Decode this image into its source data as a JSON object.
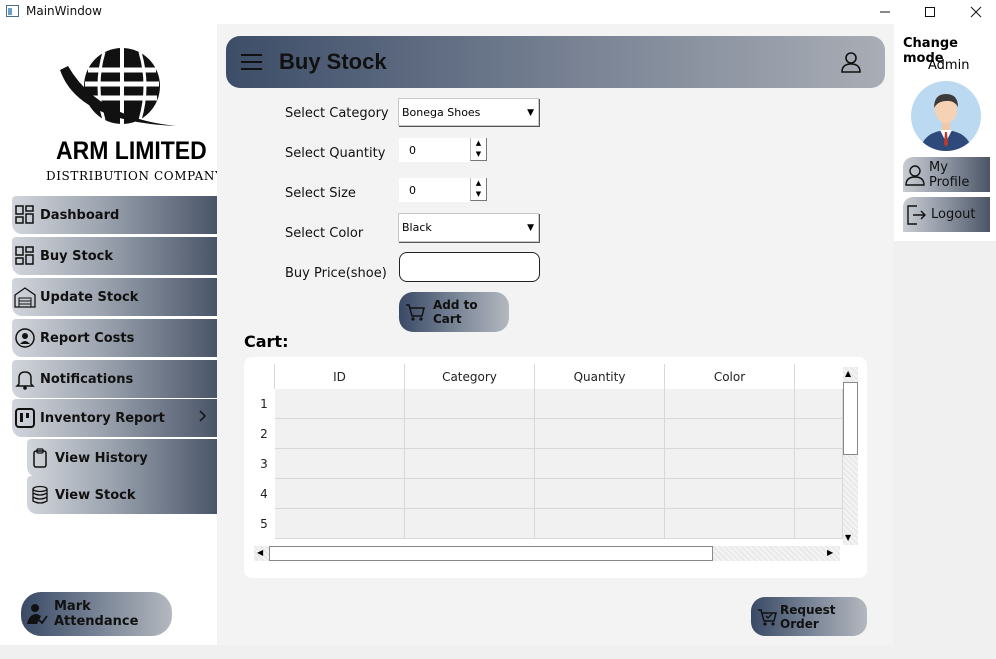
{
  "window": {
    "title": "MainWindow",
    "min_icon": "minimize-icon",
    "max_icon": "maximize-icon",
    "close_icon": "close-icon"
  },
  "logo": {
    "line1": "ARM LIMITED",
    "line2": "DISTRIBUTION COMPANY"
  },
  "sidebar": {
    "items": [
      {
        "label": "Dashboard",
        "icon": "dashboard-icon"
      },
      {
        "label": "Buy Stock",
        "icon": "grid-icon"
      },
      {
        "label": "Update Stock",
        "icon": "warehouse-icon"
      },
      {
        "label": "Report Costs",
        "icon": "cost-report-icon"
      },
      {
        "label": "Notifications",
        "icon": "bell-icon"
      },
      {
        "label": "Inventory Report",
        "icon": "board-icon"
      },
      {
        "label": "View History",
        "icon": "clipboard-icon"
      },
      {
        "label": "View Stock",
        "icon": "database-icon"
      }
    ],
    "attendance_label": "Mark Attendance"
  },
  "header": {
    "title": "Buy Stock"
  },
  "form": {
    "category_label": "Select Category",
    "category_value": "Bonega Shoes",
    "quantity_label": "Select Quantity",
    "quantity_value": "0",
    "size_label": "Select Size",
    "size_value": "0",
    "color_label": "Select Color",
    "color_value": "Black",
    "price_label": "Buy Price(shoe)",
    "price_value": "",
    "add_to_cart_label": "Add to Cart"
  },
  "cart": {
    "title": "Cart:",
    "columns": [
      "ID",
      "Category",
      "Quantity",
      "Color"
    ],
    "row_numbers": [
      "1",
      "2",
      "3",
      "4",
      "5"
    ]
  },
  "request_order_label": "Request Order",
  "profile": {
    "change_mode_label": "Change mode",
    "role": "Admin",
    "my_profile_label": "My Profile",
    "logout_label": "Logout"
  },
  "colors": {
    "accent_dark": "#3d4d68",
    "accent_light": "#a9adb5"
  }
}
